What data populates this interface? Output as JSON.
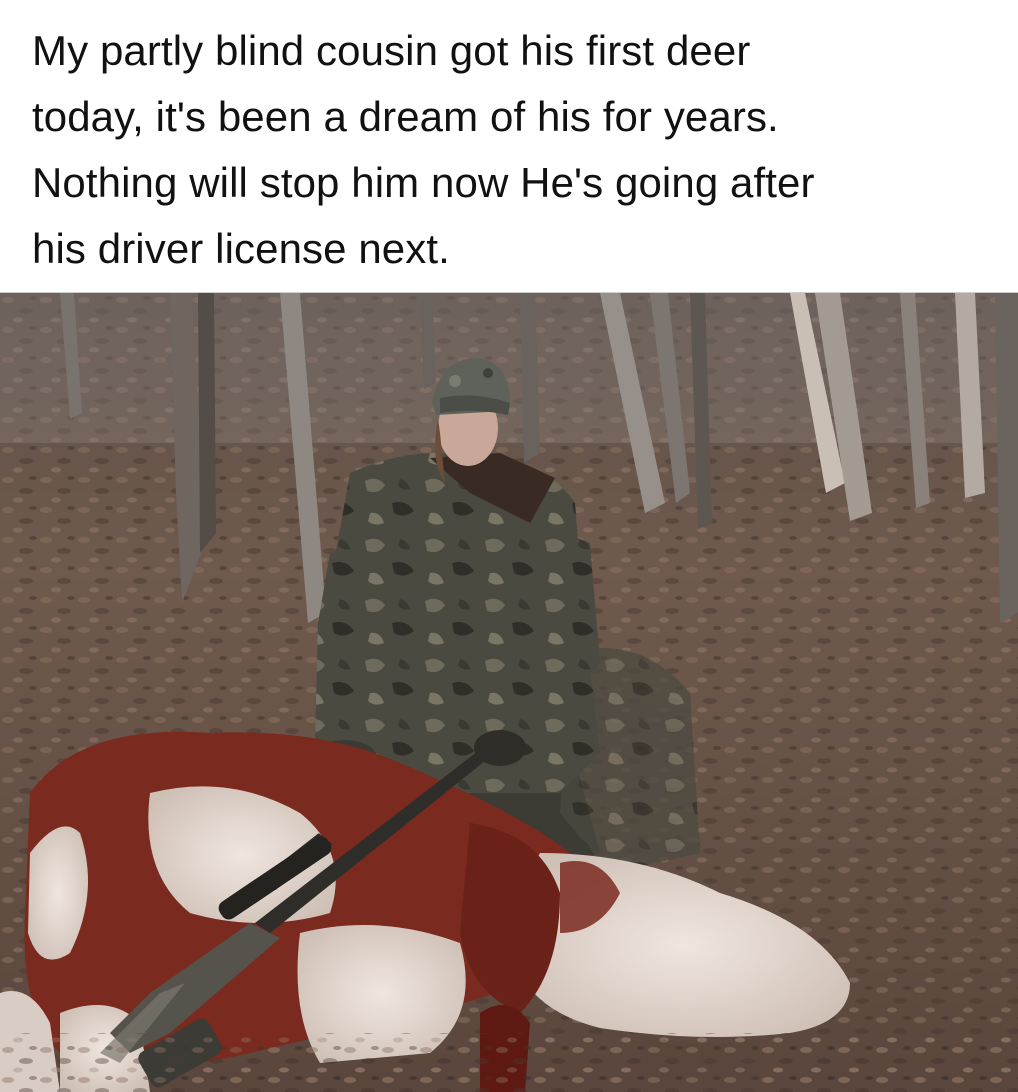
{
  "caption": {
    "lines": [
      "My partly blind cousin got his first deer",
      "today, it's been a dream of his for years.",
      "Nothing will stop him now  He's going after",
      "his driver license next."
    ]
  },
  "photo": {
    "subjects": [
      "hunter-in-camo",
      "hereford-cow",
      "scoped-rifle",
      "forest-floor",
      "bare-trees"
    ],
    "colors": {
      "leaf_floor": "#6b5548",
      "tree_bark": "#8c8580",
      "camo_jacket": "#4a4a3e",
      "cow_red": "#7a2a1e",
      "cow_white": "#e8ddd6"
    }
  }
}
